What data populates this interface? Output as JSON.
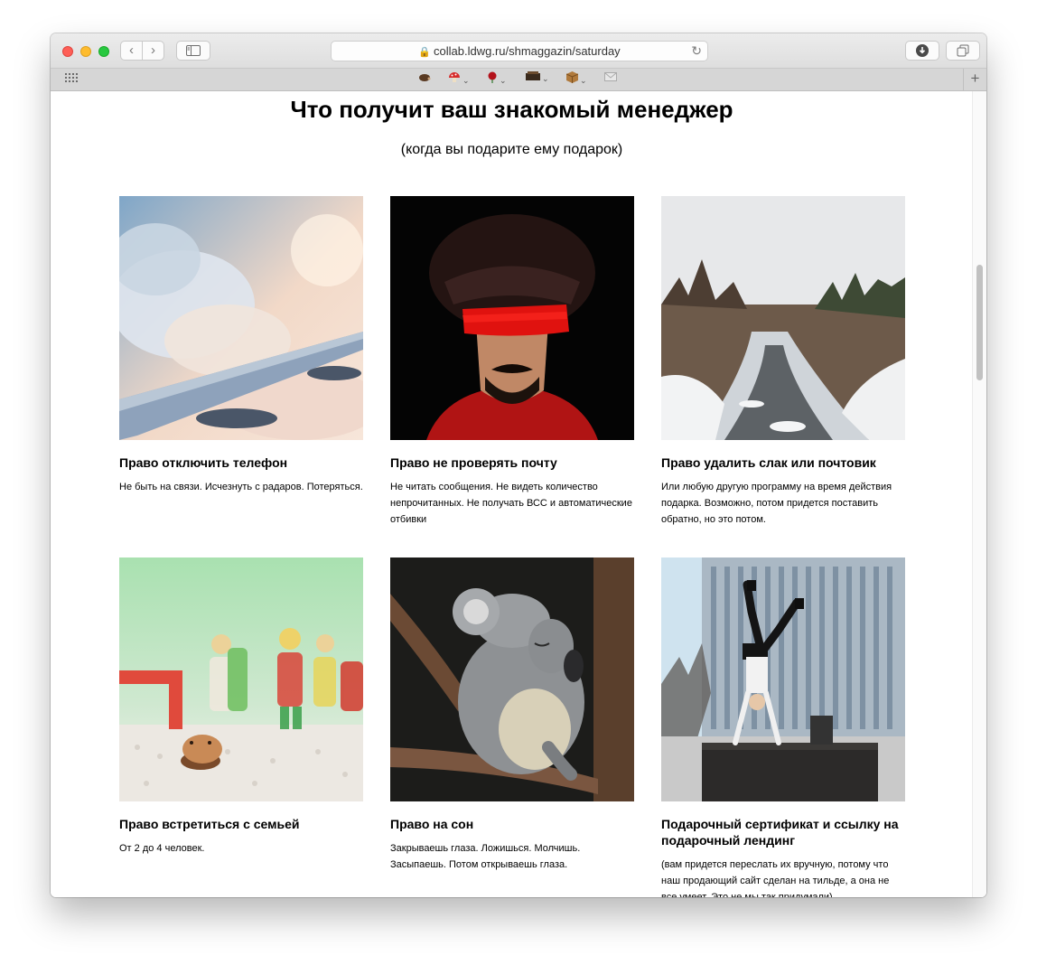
{
  "browser": {
    "url": "collab.ldwg.ru/shmaggazin/saturday",
    "nav": {
      "back": "‹",
      "forward": "›"
    },
    "favorites_icons": [
      "hedgehog-icon",
      "mushroom-icon",
      "rose-icon",
      "box-icon",
      "package-icon",
      "mail-icon"
    ]
  },
  "page": {
    "title": "Что получит ваш знакомый менеджер",
    "subtitle": "(когда вы подарите ему подарок)"
  },
  "cards": [
    {
      "title": "Право отключить телефон",
      "text": "Не быть на связи. Исчезнуть с радаров. Потеряться.",
      "image": "airplane-wing-clouds"
    },
    {
      "title": "Право не проверять почту",
      "text": "Не читать сообщения. Не видеть количество непрочитанных. Не получать ВСС и автоматические отбивки",
      "image": "blindfolded-man"
    },
    {
      "title": "Право удалить слак или почтовик",
      "text": "Или любую другую программу на время действия подарка. Возможно, потом придется поставить обратно, но это потом.",
      "image": "snowy-river"
    },
    {
      "title": "Право встретиться с семьей",
      "text": "От 2 до 4 человек.",
      "image": "toy-figures"
    },
    {
      "title": "Право на сон",
      "text": "Закрываешь глаза. Ложишься. Молчишь. Засыпаешь. Потом открываешь глаза.",
      "image": "sleeping-koala"
    },
    {
      "title": "Подарочный сертификат и ссылку на подарочный лендинг",
      "text": "(вам придется переслать их вручную, потому что наш продающий сайт сделан на тильде, а она не все умеет. Это не мы так придумали)",
      "image": "handstand-building"
    }
  ]
}
